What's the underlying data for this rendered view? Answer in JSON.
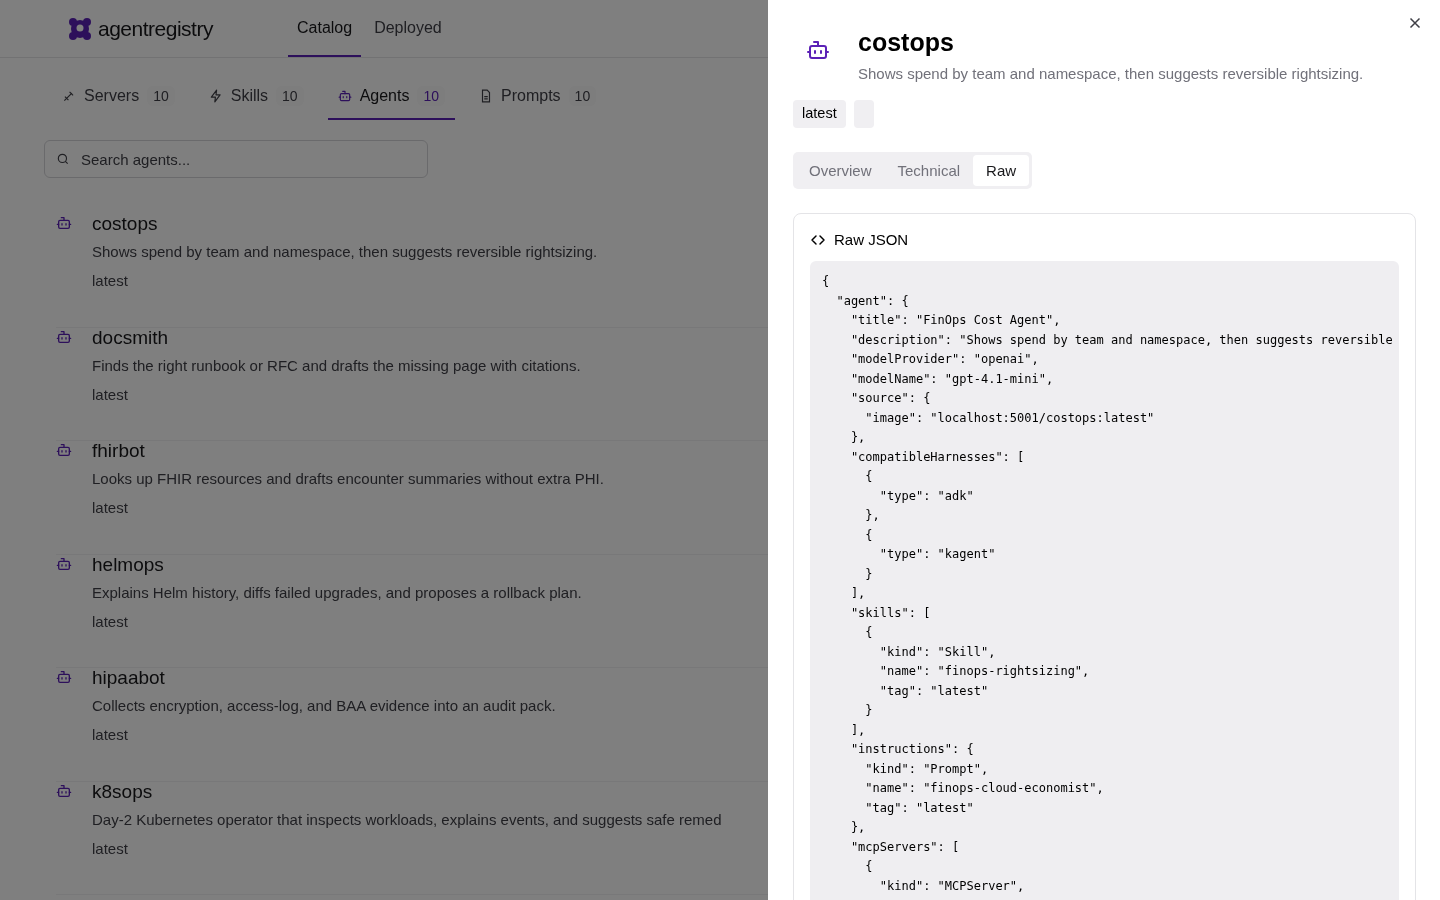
{
  "app": {
    "logo": "agentregistry",
    "nav": [
      {
        "label": "Catalog",
        "selected": true
      },
      {
        "label": "Deployed",
        "selected": false
      }
    ]
  },
  "category_tabs": [
    {
      "kind": "servers",
      "label": "Servers",
      "count": "10",
      "selected": false
    },
    {
      "kind": "skills",
      "label": "Skills",
      "count": "10",
      "selected": false
    },
    {
      "kind": "agents",
      "label": "Agents",
      "count": "10",
      "selected": true
    },
    {
      "kind": "prompts",
      "label": "Prompts",
      "count": "10",
      "selected": false
    }
  ],
  "search": {
    "placeholder": "Search agents..."
  },
  "agents": [
    {
      "name": "costops",
      "description": "Shows spend by team and namespace, then suggests reversible rightsizing.",
      "tag": "latest"
    },
    {
      "name": "docsmith",
      "description": "Finds the right runbook or RFC and drafts the missing page with citations.",
      "tag": "latest"
    },
    {
      "name": "fhirbot",
      "description": "Looks up FHIR resources and drafts encounter summaries without extra PHI.",
      "tag": "latest"
    },
    {
      "name": "helmops",
      "description": "Explains Helm history, diffs failed upgrades, and proposes a rollback plan.",
      "tag": "latest"
    },
    {
      "name": "hipaabot",
      "description": "Collects encryption, access-log, and BAA evidence into an audit pack.",
      "tag": "latest"
    },
    {
      "name": "k8sops",
      "description": "Day-2 Kubernetes operator that inspects workloads, explains events, and suggests safe remed",
      "tag": "latest"
    }
  ],
  "drawer": {
    "title": "costops",
    "description": "Shows spend by team and namespace, then suggests reversible rightsizing.",
    "badges": [
      {
        "kind": "text",
        "label": "latest"
      },
      {
        "kind": "blank"
      }
    ],
    "tabs": [
      {
        "label": "Overview",
        "selected": false
      },
      {
        "label": "Technical",
        "selected": false
      },
      {
        "label": "Raw",
        "selected": true
      }
    ],
    "panel": {
      "title": "Raw JSON",
      "code_lines": [
        "{",
        "  \"agent\": {",
        "    \"title\": \"FinOps Cost Agent\",",
        "    \"description\": \"Shows spend by team and namespace, then suggests reversible",
        "    \"modelProvider\": \"openai\",",
        "    \"modelName\": \"gpt-4.1-mini\",",
        "    \"source\": {",
        "      \"image\": \"localhost:5001/costops:latest\"",
        "    },",
        "    \"compatibleHarnesses\": [",
        "      {",
        "        \"type\": \"adk\"",
        "      },",
        "      {",
        "        \"type\": \"kagent\"",
        "      }",
        "    ],",
        "    \"skills\": [",
        "      {",
        "        \"kind\": \"Skill\",",
        "        \"name\": \"finops-rightsizing\",",
        "        \"tag\": \"latest\"",
        "      }",
        "    ],",
        "    \"instructions\": {",
        "      \"kind\": \"Prompt\",",
        "      \"name\": \"finops-cloud-economist\",",
        "      \"tag\": \"latest\"",
        "    },",
        "    \"mcpServers\": [",
        "      {",
        "        \"kind\": \"MCPServer\","
      ]
    }
  }
}
